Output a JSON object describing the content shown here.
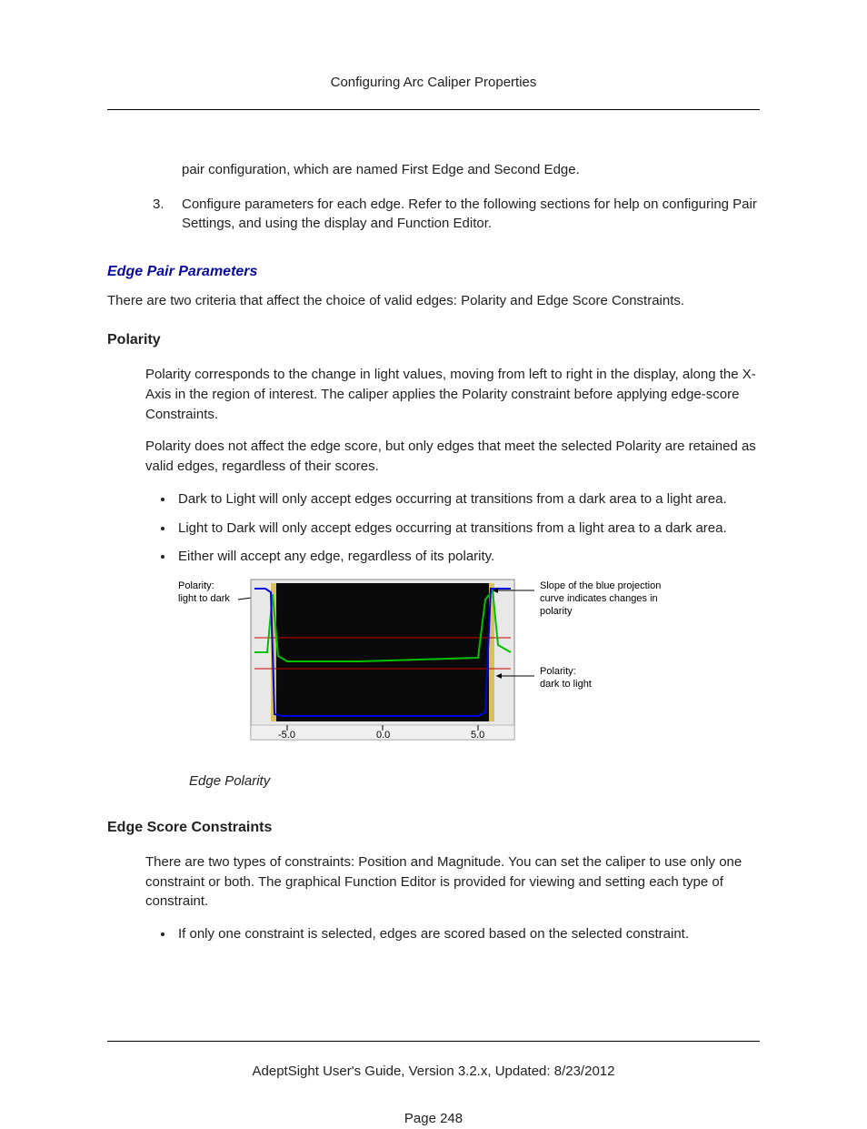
{
  "header": {
    "title": "Configuring Arc Caliper Properties"
  },
  "orphan_line": "pair configuration, which are named First Edge and Second Edge.",
  "step3": {
    "num": "3.",
    "text": "Configure parameters for each edge. Refer to the following sections for help on configuring Pair Settings, and using the display and Function Editor."
  },
  "edge_pair": {
    "heading": "Edge Pair Parameters",
    "para": "There are two criteria that affect the choice of valid edges: Polarity and Edge Score Constraints."
  },
  "polarity": {
    "heading": "Polarity",
    "p1": "Polarity corresponds to the change in light values, moving from left to right in the display, along the X-Axis in the region of interest. The caliper applies the Polarity constraint before applying edge-score Constraints.",
    "p2": "Polarity does not affect the edge score, but only edges that meet the selected Polarity are retained as valid edges, regardless of their scores.",
    "b1": "Dark to Light will only accept edges occurring at transitions from a dark area to a light area.",
    "b2": "Light to Dark will only accept edges occurring at transitions from a light area to a dark area.",
    "b3": "Either will accept any edge, regardless of its polarity."
  },
  "figure": {
    "label_left_1": "Polarity:",
    "label_left_2": "light to dark",
    "label_right_top_1": "Slope of the blue projection",
    "label_right_top_2": "curve indicates changes in",
    "label_right_top_3": "polarity",
    "label_right_bot_1": "Polarity:",
    "label_right_bot_2": "dark to light",
    "tick_neg": "-5.0",
    "tick_zero": "0.0",
    "tick_pos": "5.0",
    "caption": "Edge Polarity"
  },
  "edge_score": {
    "heading": "Edge Score Constraints",
    "p1": "There are two types of constraints: Position and Magnitude. You can set the caliper to use only one constraint or both. The graphical Function Editor is provided for viewing and setting each type of constraint.",
    "b1": "If only one constraint is selected, edges are scored based on the selected constraint."
  },
  "footer": {
    "line": "AdeptSight User's Guide,  Version 3.2.x, Updated: 8/23/2012",
    "page": "Page 248"
  }
}
